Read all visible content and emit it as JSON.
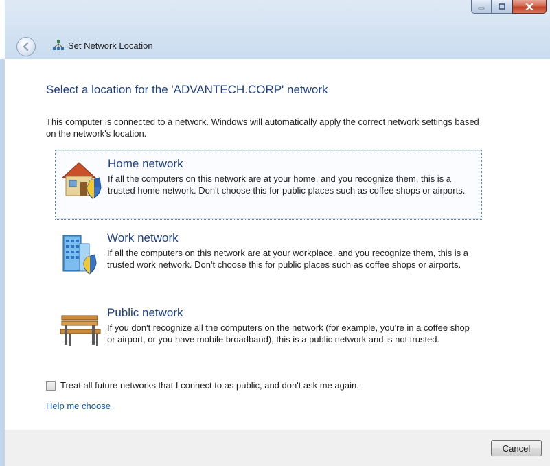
{
  "window": {
    "title": "Set Network Location",
    "caption_buttons": [
      "minimize-icon",
      "maximize-icon",
      "close-icon"
    ]
  },
  "heading": "Select a location for the 'ADVANTECH.CORP' network",
  "intro": "This computer is connected to a network. Windows will automatically apply the correct network settings based on the network's location.",
  "options": [
    {
      "title": "Home network",
      "description": "If all the computers on this network are at your home, and you recognize them, this is a trusted home network.  Don't choose this for public places such as coffee shops or airports.",
      "icon": "home-network-icon"
    },
    {
      "title": "Work network",
      "description": "If all the computers on this network are at your workplace, and you recognize them, this is a trusted work network.  Don't choose this for public places such as coffee shops or airports.",
      "icon": "work-network-icon"
    },
    {
      "title": "Public network",
      "description": "If you don't recognize all the computers on the network (for example, you're in a coffee shop or airport, or you have mobile broadband), this is a public network and is not trusted.",
      "icon": "public-network-icon"
    }
  ],
  "checkbox": {
    "label": "Treat all future networks that I connect to as public, and don't ask me again.",
    "checked": false
  },
  "help_link": "Help me choose",
  "footer": {
    "cancel_label": "Cancel"
  },
  "colors": {
    "heading": "#1e3f8a",
    "link": "#0b56b8",
    "footer_bg": "#f0f0f0"
  }
}
